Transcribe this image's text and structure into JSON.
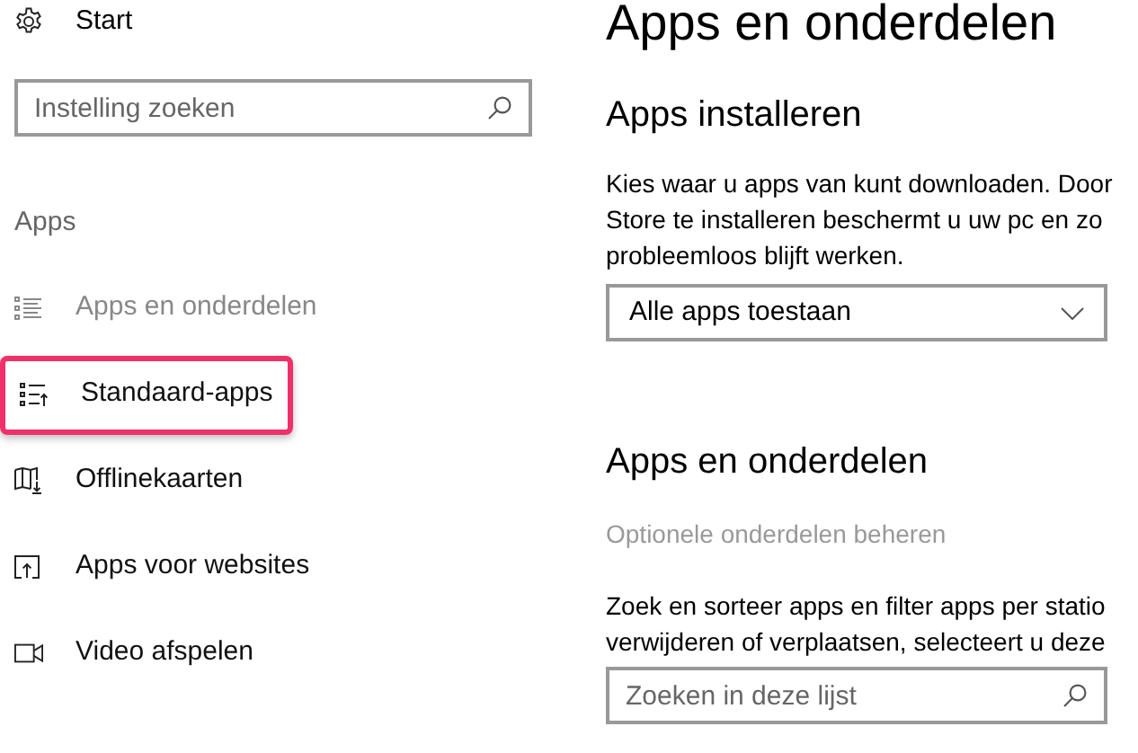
{
  "sidebar": {
    "home": {
      "label": "Start"
    },
    "search": {
      "placeholder": "Instelling zoeken"
    },
    "section": "Apps",
    "items": [
      {
        "kind": "list",
        "label": "Apps en onderdelen",
        "selected": true,
        "highlighted": false
      },
      {
        "kind": "defaults",
        "label": "Standaard-apps",
        "selected": false,
        "highlighted": true
      },
      {
        "kind": "map",
        "label": "Offlinekaarten",
        "selected": false,
        "highlighted": false
      },
      {
        "kind": "upload",
        "label": "Apps voor websites",
        "selected": false,
        "highlighted": false
      },
      {
        "kind": "video",
        "label": "Video afspelen",
        "selected": false,
        "highlighted": false
      }
    ]
  },
  "page": {
    "title": "Apps en onderdelen",
    "install": {
      "heading": "Apps installeren",
      "description_lines": [
        "Kies waar u apps van kunt downloaden. Door",
        "Store te installeren beschermt u uw pc en zo",
        "probleemloos blijft werken."
      ],
      "dropdown": {
        "value": "Alle apps toestaan"
      }
    },
    "features": {
      "heading": "Apps en onderdelen",
      "link": "Optionele onderdelen beheren",
      "description_lines": [
        "Zoek en sorteer apps en filter apps per statio",
        "verwijderen of verplaatsen, selecteert u deze"
      ],
      "search": {
        "placeholder": "Zoeken in deze lijst"
      }
    }
  }
}
